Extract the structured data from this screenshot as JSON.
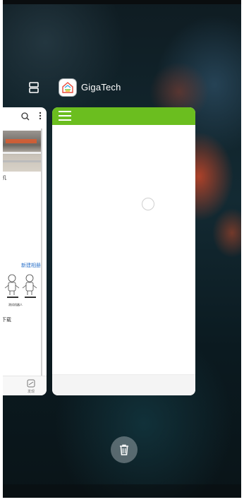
{
  "recents": {
    "app_title": "GigaTech",
    "app_icon": "home-icon",
    "split_screen_icon": "split-screen-icon",
    "clear_all_icon": "trash-icon"
  },
  "left_card": {
    "toolbar_icons": [
      "search-icon",
      "more-vertical-icon"
    ],
    "text_ji": "机",
    "link_new_album": "新建相册",
    "tiny_caption": "测试机器人",
    "text_download": "下载",
    "bottom_nav_label": "发现"
  },
  "main_card": {
    "appbar_color": "#6bbe1f",
    "menu_icon": "hamburger-menu-icon",
    "loading_icon": "loading-spinner-icon"
  }
}
